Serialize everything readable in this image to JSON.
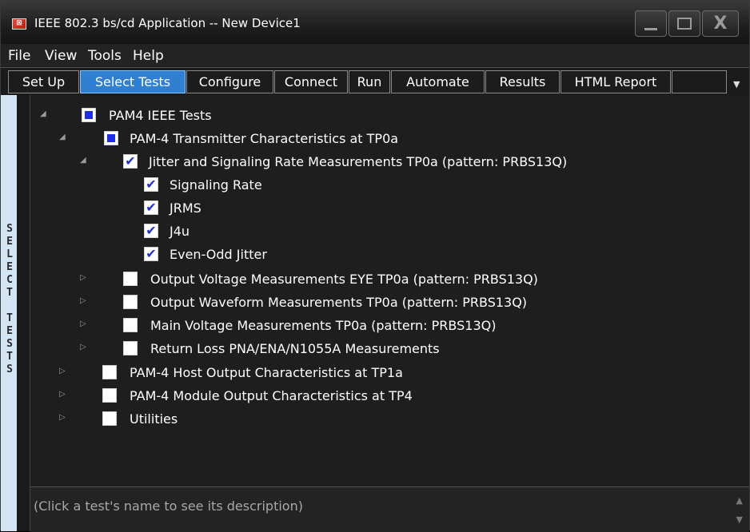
{
  "window": {
    "title": "IEEE 802.3 bs/cd Application -- New Device1",
    "icon_glyph": "⊠"
  },
  "menu": [
    "File",
    "View",
    "Tools",
    "Help"
  ],
  "tabs": [
    {
      "label": "Set Up",
      "active": false
    },
    {
      "label": "Select Tests",
      "active": true
    },
    {
      "label": "Configure",
      "active": false
    },
    {
      "label": "Connect",
      "active": false
    },
    {
      "label": "Run",
      "active": false
    },
    {
      "label": "Automate",
      "active": false
    },
    {
      "label": "Results",
      "active": false
    },
    {
      "label": "HTML Report",
      "active": false
    }
  ],
  "side_label": "SELECT TESTS",
  "tree": [
    {
      "label": "PAM4 IEEE Tests",
      "state": "partial",
      "expanded": true
    },
    {
      "label": "PAM-4 Transmitter Characteristics at TP0a",
      "state": "partial",
      "expanded": true
    },
    {
      "label": "Jitter and Signaling Rate Measurements TP0a (pattern: PRBS13Q)",
      "state": "checked",
      "expanded": true,
      "selected": true
    },
    {
      "label": "Signaling Rate",
      "state": "checked"
    },
    {
      "label": "JRMS",
      "state": "checked"
    },
    {
      "label": "J4u",
      "state": "checked"
    },
    {
      "label": "Even-Odd Jitter",
      "state": "checked"
    },
    {
      "label": "Output Voltage Measurements EYE TP0a (pattern: PRBS13Q)",
      "state": "unchecked",
      "expanded": false
    },
    {
      "label": "Output Waveform Measurements TP0a (pattern: PRBS13Q)",
      "state": "unchecked",
      "expanded": false
    },
    {
      "label": "Main Voltage Measurements TP0a (pattern: PRBS13Q)",
      "state": "unchecked",
      "expanded": false
    },
    {
      "label": "Return Loss PNA/ENA/N1055A Measurements",
      "state": "unchecked",
      "expanded": false
    },
    {
      "label": "PAM-4 Host Output Characteristics at TP1a",
      "state": "unchecked",
      "expanded": false
    },
    {
      "label": "PAM-4 Module Output Characteristics at TP4",
      "state": "unchecked",
      "expanded": false
    },
    {
      "label": "Utilities",
      "state": "unchecked",
      "expanded": false
    }
  ],
  "description": "(Click a test's name to see its description)",
  "icons": {
    "expanded": "◢",
    "collapsed": "▷",
    "check": "✔",
    "tab_overflow": "▼",
    "scroll_up": "▲",
    "scroll_down": "▼",
    "close": "X"
  },
  "colors": {
    "selection": "#2f7fd2",
    "partial_fill": "#1d2ee6",
    "side_label_bg": "#d3e4f5"
  }
}
